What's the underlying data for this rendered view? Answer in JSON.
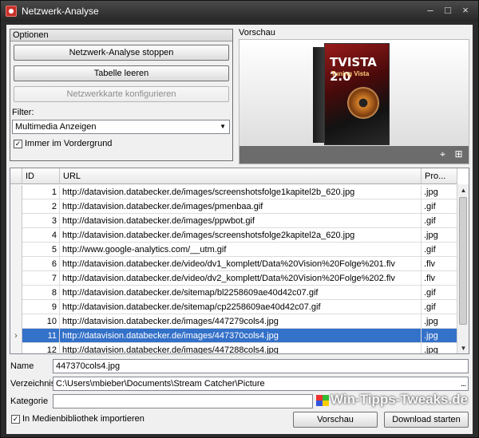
{
  "window": {
    "title": "Netzwerk-Analyse",
    "minimize": "–",
    "maximize": "□",
    "close": "×"
  },
  "options": {
    "header": "Optionen",
    "stop_button": "Netzwerk-Analyse stoppen",
    "clear_button": "Tabelle leeren",
    "configure_button": "Netzwerkkarte konfigurieren",
    "filter_label": "Filter:",
    "filter_value": "Multimedia Anzeigen",
    "always_on_top_label": "Immer im Vordergrund",
    "always_on_top_checked": true
  },
  "preview": {
    "label": "Vorschau",
    "product_title": "TVISTA 2.0",
    "product_subtitle": "Tuning Vista"
  },
  "table": {
    "columns": [
      "ID",
      "URL",
      "Pro..."
    ],
    "rows": [
      {
        "id": "1",
        "url": "http://datavision.databecker.de/images/screenshotsfolge1kapitel2b_620.jpg",
        "pro": ".jpg"
      },
      {
        "id": "2",
        "url": "http://datavision.databecker.de/images/pmenbaa.gif",
        "pro": ".gif"
      },
      {
        "id": "3",
        "url": "http://datavision.databecker.de/images/ppwbot.gif",
        "pro": ".gif"
      },
      {
        "id": "4",
        "url": "http://datavision.databecker.de/images/screenshotsfolge2kapitel2a_620.jpg",
        "pro": ".jpg"
      },
      {
        "id": "5",
        "url": "http://www.google-analytics.com/__utm.gif",
        "pro": ".gif"
      },
      {
        "id": "6",
        "url": "http://datavision.databecker.de/video/dv1_komplett/Data%20Vision%20Folge%201.flv",
        "pro": ".flv"
      },
      {
        "id": "7",
        "url": "http://datavision.databecker.de/video/dv2_komplett/Data%20Vision%20Folge%202.flv",
        "pro": ".flv"
      },
      {
        "id": "8",
        "url": "http://datavision.databecker.de/sitemap/bl2258609ae40d42c07.gif",
        "pro": ".gif"
      },
      {
        "id": "9",
        "url": "http://datavision.databecker.de/sitemap/cp2258609ae40d42c07.gif",
        "pro": ".gif"
      },
      {
        "id": "10",
        "url": "http://datavision.databecker.de/images/447279cols4.jpg",
        "pro": ".jpg"
      },
      {
        "id": "11",
        "url": "http://datavision.databecker.de/images/447370cols4.jpg",
        "pro": ".jpg",
        "selected": true
      },
      {
        "id": "12",
        "url": "http://datavision.databecker.de/images/447288cols4.jpg",
        "pro": ".jpg"
      }
    ]
  },
  "form": {
    "name_label": "Name",
    "name_value": "447370cols4.jpg",
    "dir_label": "Verzeichnis",
    "dir_value": "C:\\Users\\mbieber\\Documents\\Stream Catcher\\Picture",
    "dir_browse": "...",
    "category_label": "Kategorie",
    "category_value": "",
    "import_label": "In Medienbibliothek importieren",
    "import_checked": true,
    "preview_button": "Vorschau",
    "download_button": "Download starten"
  },
  "watermark": "Win-Tipps-Tweaks.de"
}
